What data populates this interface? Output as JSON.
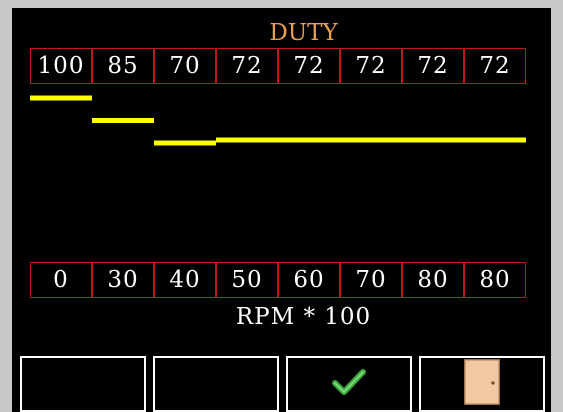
{
  "header": {
    "title": "DUTY",
    "title_color": "#e8a050"
  },
  "duty_values": [
    "100",
    "85",
    "70",
    "72",
    "72",
    "72",
    "72",
    "72"
  ],
  "rpm_values": [
    "0",
    "30",
    "40",
    "50",
    "60",
    "70",
    "80",
    "80"
  ],
  "rpm_label": "RPM * 100",
  "colors": {
    "cell_border": "#c01818",
    "graph_line": "#ffff00",
    "text": "#ffffff",
    "confirm_check": "#3aa83a",
    "door": "#f2c8a0"
  },
  "buttons": [
    {
      "name": "empty-button-1",
      "icon": "none"
    },
    {
      "name": "empty-button-2",
      "icon": "none"
    },
    {
      "name": "confirm-button",
      "icon": "checkmark-icon"
    },
    {
      "name": "exit-button",
      "icon": "door-icon"
    }
  ]
}
